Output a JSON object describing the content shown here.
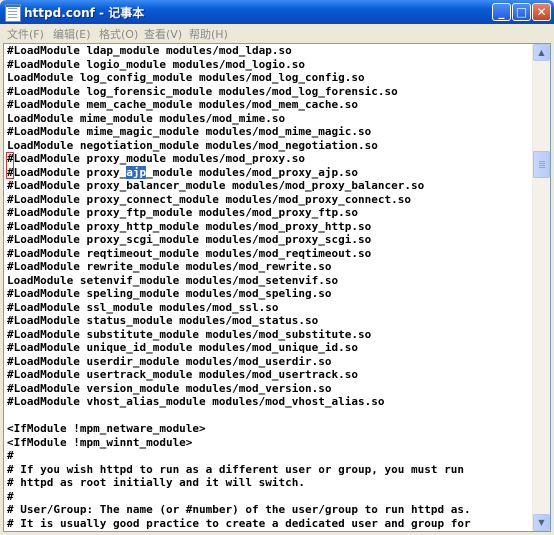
{
  "window": {
    "title": "httpd.conf - 记事本",
    "minimize": "_",
    "maximize": "□",
    "close": "✕"
  },
  "menu": [
    "文件(F)",
    "编辑(E)",
    "格式(O)",
    "查看(V)",
    "帮助(H)"
  ],
  "lines": [
    "#LoadModule ldap_module modules/mod_ldap.so",
    "#LoadModule logio_module modules/mod_logio.so",
    "LoadModule log_config_module modules/mod_log_config.so",
    "#LoadModule log_forensic_module modules/mod_log_forensic.so",
    "#LoadModule mem_cache_module modules/mod_mem_cache.so",
    "LoadModule mime_module modules/mod_mime.so",
    "#LoadModule mime_magic_module modules/mod_mime_magic.so",
    "LoadModule negotiation_module modules/mod_negotiation.so",
    "#LoadModule proxy_module modules/mod_proxy.so",
    "#LoadModule proxy_ajp_module modules/mod_proxy_ajp.so",
    "#LoadModule proxy_balancer_module modules/mod_proxy_balancer.so",
    "#LoadModule proxy_connect_module modules/mod_proxy_connect.so",
    "#LoadModule proxy_ftp_module modules/mod_proxy_ftp.so",
    "#LoadModule proxy_http_module modules/mod_proxy_http.so",
    "#LoadModule proxy_scgi_module modules/mod_proxy_scgi.so",
    "#LoadModule reqtimeout_module modules/mod_reqtimeout.so",
    "#LoadModule rewrite_module modules/mod_rewrite.so",
    "LoadModule setenvif_module modules/mod_setenvif.so",
    "#LoadModule speling_module modules/mod_speling.so",
    "#LoadModule ssl_module modules/mod_ssl.so",
    "#LoadModule status_module modules/mod_status.so",
    "#LoadModule substitute_module modules/mod_substitute.so",
    "#LoadModule unique_id_module modules/mod_unique_id.so",
    "#LoadModule userdir_module modules/mod_userdir.so",
    "#LoadModule usertrack_module modules/mod_usertrack.so",
    "#LoadModule version_module modules/mod_version.so",
    "#LoadModule vhost_alias_module modules/mod_vhost_alias.so",
    "",
    "<IfModule !mpm_netware_module>",
    "<IfModule !mpm_winnt_module>",
    "#",
    "# If you wish httpd to run as a different user or group, you must run",
    "# httpd as root initially and it will switch.",
    "#",
    "# User/Group: The name (or #number) of the user/group to run httpd as.",
    "# It is usually good practice to create a dedicated user and group for"
  ],
  "selection": {
    "line": 9,
    "text": "ajp"
  },
  "scrollbar": {
    "up": "▲",
    "down": "▼"
  }
}
